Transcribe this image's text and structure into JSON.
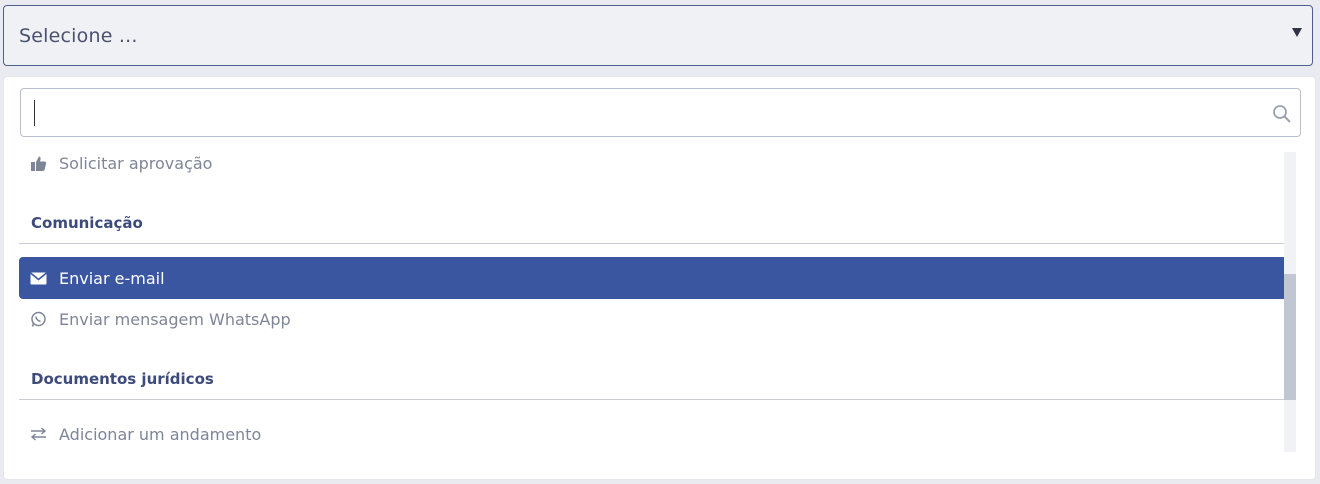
{
  "select": {
    "placeholder": "Selecione ..."
  },
  "search": {
    "value": "",
    "placeholder": ""
  },
  "list": {
    "items": [
      {
        "type": "option",
        "label": "Solicitar aprovação",
        "icon": "thumbs-up-icon",
        "active": false
      },
      {
        "type": "group",
        "label": "Comunicação"
      },
      {
        "type": "option",
        "label": "Enviar e-mail",
        "icon": "envelope-icon",
        "active": true
      },
      {
        "type": "option",
        "label": "Enviar mensagem WhatsApp",
        "icon": "whatsapp-icon",
        "active": false
      },
      {
        "type": "group",
        "label": "Documentos jurídicos"
      },
      {
        "type": "option",
        "label": "Adicionar um andamento",
        "icon": "exchange-arrows-icon",
        "active": false
      }
    ]
  },
  "colors": {
    "accent": "#3a56a0",
    "group_text": "#3d4b7c",
    "option_text": "#7f8598"
  }
}
